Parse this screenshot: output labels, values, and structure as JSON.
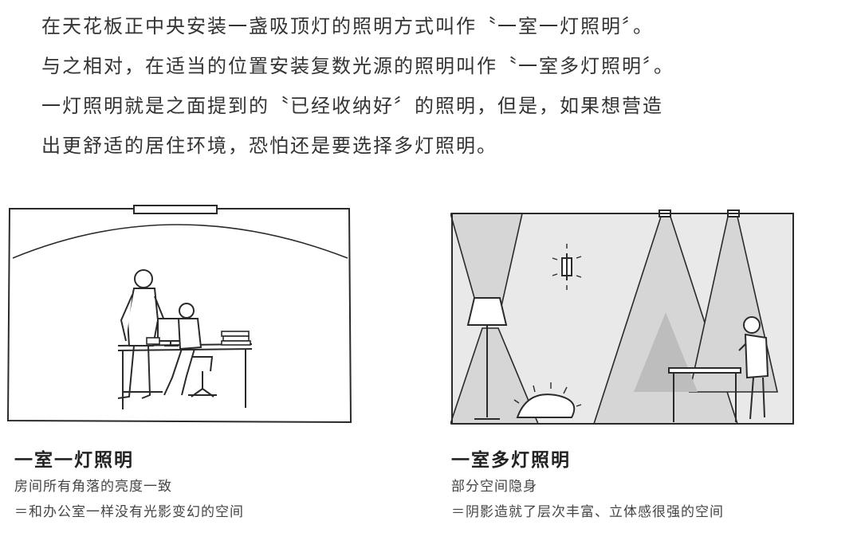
{
  "intro": {
    "lines": [
      "在天花板正中央安装一盏吸顶灯的照明方式叫作〝一室一灯照明〞。",
      "与之相对，在适当的位置安装复数光源的照明叫作〝一室多灯照明〞。",
      "一灯照明就是之面提到的〝已经收纳好〞的照明，但是，如果想营造",
      "出更舒适的居住环境，恐怕还是要选择多灯照明。"
    ]
  },
  "left_panel": {
    "title": "一室一灯照明",
    "subtitle": "房间所有角落的亮度一致",
    "note": "＝和办公室一样没有光影变幻的空间"
  },
  "right_panel": {
    "title": "一室多灯照明",
    "subtitle": "部分空间隐身",
    "note": "＝阴影造就了层次丰富、立体感很强的空间"
  },
  "colors": {
    "text": "#333333",
    "line": "#2a2a2a",
    "light_cone": "#e2e2e2",
    "shadow": "#c4c4c4"
  }
}
